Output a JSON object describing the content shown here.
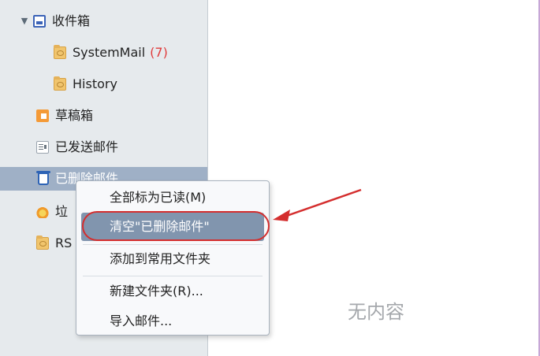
{
  "sidebar": {
    "inbox": {
      "label": "收件箱"
    },
    "inbox_children": [
      {
        "label": "SystemMail",
        "count": "(7)"
      },
      {
        "label": "History"
      }
    ],
    "drafts": {
      "label": "草稿箱"
    },
    "sent": {
      "label": "已发送邮件"
    },
    "deleted": {
      "label": "已删除邮件"
    },
    "junk": {
      "label": "垃"
    },
    "rss": {
      "label": "RS"
    }
  },
  "context_menu": {
    "items": [
      {
        "label": "全部标为已读(M)"
      },
      {
        "label": "清空\"已删除邮件\""
      },
      {
        "label": "添加到常用文件夹"
      },
      {
        "label": "新建文件夹(R)..."
      },
      {
        "label": "导入邮件..."
      }
    ]
  },
  "main": {
    "empty_text": "无内容"
  },
  "colors": {
    "annotation": "#d42e2e"
  }
}
